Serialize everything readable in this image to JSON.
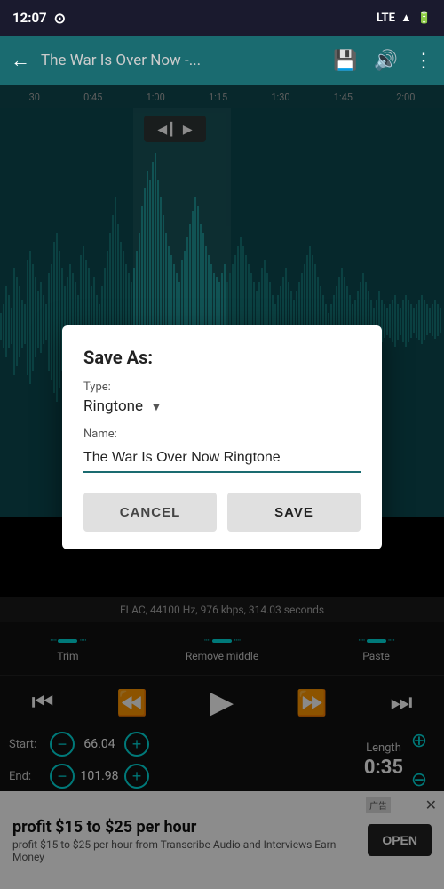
{
  "statusBar": {
    "time": "12:07",
    "network": "LTE",
    "iconNotif": "⊙"
  },
  "actionBar": {
    "backIcon": "←",
    "title": "The War Is Over Now -...",
    "saveIcon": "💾",
    "volumeIcon": "🔊",
    "moreIcon": "⋮"
  },
  "timeline": {
    "markers": [
      "30",
      "0:45",
      "1:00",
      "1:15",
      "1:30",
      "1:45",
      "2:00"
    ]
  },
  "dialog": {
    "title": "Save As:",
    "typeLabel": "Type:",
    "typeValue": "Ringtone",
    "nameLabel": "Name:",
    "nameValue": "The War Is Over Now Ringtone",
    "cancelLabel": "CANCEL",
    "saveLabel": "SAVE"
  },
  "infoBar": {
    "text": "FLAC, 44100 Hz, 976 kbps, 314.03 seconds"
  },
  "editTools": [
    {
      "icon": "⋯▬⋯",
      "label": "Trim"
    },
    {
      "icon": "⋯▬⋯",
      "label": "Remove middle"
    },
    {
      "icon": "⋯▬⋯",
      "label": "Paste"
    }
  ],
  "transport": {
    "skipBackIcon": "⏮",
    "rewindIcon": "⏪",
    "playIcon": "▶",
    "fastForwardIcon": "⏩",
    "skipForwardIcon": "⏭"
  },
  "params": {
    "startLabel": "Start:",
    "startValue": "66.04",
    "endLabel": "End:",
    "endValue": "101.98",
    "lengthLabel": "Length",
    "lengthValue": "0:35"
  },
  "adBanner": {
    "badge": "广告",
    "title": "profit $15 to $25 per hour",
    "subtitle": "profit $15 to $25 per hour from Transcribe Audio and Interviews Earn Money",
    "openLabel": "OPEN"
  }
}
